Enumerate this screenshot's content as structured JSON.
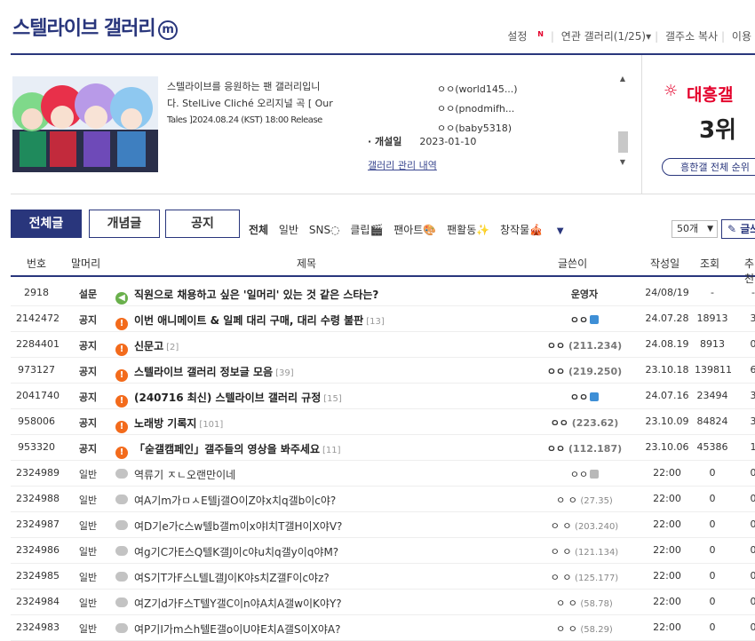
{
  "gallery": {
    "title": "스텔라이브 갤러리",
    "m_badge": "ⓜ"
  },
  "top_links": {
    "settings": "설정",
    "settings_new": "N",
    "related": "연관 갤러리(1/25)▾",
    "copy_address": "갤주소 복사",
    "more": "이용"
  },
  "info": {
    "desc_line1": "스텔라이브를 응원하는 팬 갤러리입니",
    "desc_line2": "다. StelLive Cliché 오리지널 곡 [ Our",
    "desc_line3": "Tales ]2024.08.24 (KST) 18:00 Release",
    "managers": [
      "ㅇㅇ(world145...)",
      "ㅇㅇ(pnodmifh...",
      "ㅇㅇ(baby5318)"
    ],
    "open_label": "개설일",
    "open_date": "2023-01-10",
    "history_link": "갤러리 관리 내역"
  },
  "rank": {
    "title": "대흥갤",
    "value": "3위",
    "button": "흥한갤 전체 순위"
  },
  "tabs": [
    "전체글",
    "개념글",
    "공지"
  ],
  "categories": [
    {
      "label": "전체",
      "active": true
    },
    {
      "label": "일반"
    },
    {
      "label": "SNS◌"
    },
    {
      "label": "클립🎬"
    },
    {
      "label": "팬아트🎨"
    },
    {
      "label": "팬활동✨"
    },
    {
      "label": "창작물🎪"
    }
  ],
  "count_select": "50개",
  "write_button": "✎ 글쓰기",
  "table": {
    "headers": {
      "num": "번호",
      "head": "말머리",
      "title": "제목",
      "writer": "글쓴이",
      "date": "작성일",
      "views": "조회",
      "rec": "추천"
    },
    "rows": [
      {
        "num": "2918",
        "head": "설문",
        "type": "survey",
        "title": "직원으로 채용하고 싶은 '일머리' 있는 것 같은 스타는?",
        "reply": "",
        "writer": "운영자",
        "ip": "",
        "date": "24/08/19",
        "views": "-",
        "rec": "-"
      },
      {
        "num": "2142472",
        "head": "공지",
        "type": "notice",
        "title": "이번 애니메이트 & 일페 대리 구매, 대리 수령 불판",
        "reply": "[13]",
        "writer": "ㅇㅇ",
        "ip": "",
        "date": "24.07.28",
        "views": "18913",
        "rec": "3"
      },
      {
        "num": "2284401",
        "head": "공지",
        "type": "notice",
        "title": "신문고",
        "reply": "[2]",
        "writer": "ㅇㅇ",
        "ip": "(211.234)",
        "date": "24.08.19",
        "views": "8913",
        "rec": "0"
      },
      {
        "num": "973127",
        "head": "공지",
        "type": "notice",
        "title": "스텔라이브 갤러리 정보글 모음",
        "reply": "[39]",
        "writer": "ㅇㅇ",
        "ip": "(219.250)",
        "date": "23.10.18",
        "views": "139811",
        "rec": "6"
      },
      {
        "num": "2041740",
        "head": "공지",
        "type": "notice",
        "title": "(240716 최신) 스텔라이브 갤러리 규정",
        "reply": "[15]",
        "writer": "ㅇㅇ",
        "ip": "",
        "date": "24.07.16",
        "views": "23494",
        "rec": "3"
      },
      {
        "num": "958006",
        "head": "공지",
        "type": "notice",
        "title": "노래방 기록지",
        "reply": "[101]",
        "writer": "ㅇㅇ",
        "ip": "(223.62)",
        "date": "23.10.09",
        "views": "84824",
        "rec": "3"
      },
      {
        "num": "953320",
        "head": "공지",
        "type": "notice",
        "title": "「숟갤캠페인」갤주들의 영상을 봐주세요",
        "reply": "[11]",
        "writer": "ㅇㅇ",
        "ip": "(112.187)",
        "date": "23.10.06",
        "views": "45386",
        "rec": "1"
      },
      {
        "num": "2324989",
        "head": "일반",
        "type": "chat",
        "title": "역류기 ㅈㄴ오랜만이네",
        "reply": "",
        "writer": "ㅇㅇ",
        "ip": "",
        "date": "22:00",
        "views": "0",
        "rec": "0"
      },
      {
        "num": "2324988",
        "head": "일반",
        "type": "chat",
        "title": "여A기m가ㅁㅅE텔j갤O이Z야x치q갤b이c야?",
        "reply": "",
        "writer": "ㅇ ㅇ",
        "ip": "(27.35)",
        "date": "22:00",
        "views": "0",
        "rec": "0"
      },
      {
        "num": "2324987",
        "head": "일반",
        "type": "chat",
        "title": "여D기e가c스w텔b갤m이x야l치T갤H이X야V?",
        "reply": "",
        "writer": "ㅇ ㅇ",
        "ip": "(203.240)",
        "date": "22:00",
        "views": "0",
        "rec": "0"
      },
      {
        "num": "2324986",
        "head": "일반",
        "type": "chat",
        "title": "여g기C가E스Q텔K갤J이c야u치q갤y이q야M?",
        "reply": "",
        "writer": "ㅇ ㅇ",
        "ip": "(121.134)",
        "date": "22:00",
        "views": "0",
        "rec": "0"
      },
      {
        "num": "2324985",
        "head": "일반",
        "type": "chat",
        "title": "여S기T가F스L텔L갤J이K야s치Z갤F이c야z?",
        "reply": "",
        "writer": "ㅇ ㅇ",
        "ip": "(125.177)",
        "date": "22:00",
        "views": "0",
        "rec": "0"
      },
      {
        "num": "2324984",
        "head": "일반",
        "type": "chat",
        "title": "여Z기d가F스T텔Y갤C이n야A치A갤w이K야Y?",
        "reply": "",
        "writer": "ㅇ ㅇ",
        "ip": "(58.78)",
        "date": "22:00",
        "views": "0",
        "rec": "0"
      },
      {
        "num": "2324983",
        "head": "일반",
        "type": "chat",
        "title": "여P기I가m스h텔E갤o이U야E치A갤S이X야A?",
        "reply": "",
        "writer": "ㅇ ㅇ",
        "ip": "(58.29)",
        "date": "22:00",
        "views": "0",
        "rec": "0"
      }
    ]
  },
  "colors": {
    "brand": "#29367c",
    "notice_icon": "#f36b1c",
    "survey_icon": "#6ab04c",
    "rank_red": "#e4002b"
  }
}
